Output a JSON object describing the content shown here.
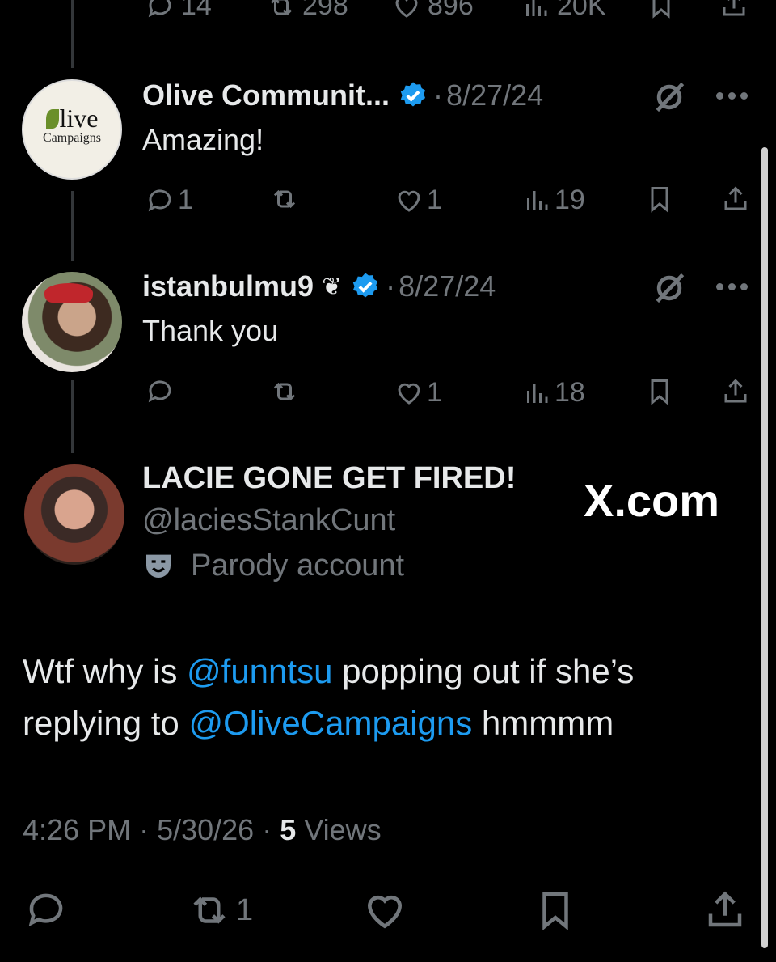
{
  "top_actions": {
    "replies": "14",
    "reposts": "298",
    "likes": "896",
    "views": "20K"
  },
  "reply1": {
    "avatar_text_main": "live",
    "avatar_text_sub": "Campaigns",
    "name": "Olive Communit...",
    "date": "8/27/24",
    "text": "Amazing!",
    "replies": "1",
    "likes": "1",
    "views": "19"
  },
  "reply2": {
    "name": "istanbulmu9",
    "emoji": "❦",
    "date": "8/27/24",
    "text": "Thank you",
    "likes": "1",
    "views": "18"
  },
  "main_post": {
    "name": "LACIE GONE GET FIRED!",
    "handle": "@laciesStankCunt",
    "parody_label": "Parody account",
    "watermark": "X.com",
    "text_part1": "Wtf why is ",
    "mention1": "@funntsu",
    "text_part2": " popping out if she’s replying to ",
    "mention2": "@OliveCampaigns",
    "text_part3": " hmmmm",
    "time": "4:26 PM",
    "date": "5/30/26",
    "views_count": "5",
    "views_label": "Views",
    "reposts": "1"
  },
  "colors": {
    "accent": "#1d9bf0",
    "muted": "#71767b",
    "text": "#e7e9ea",
    "background": "#000000"
  }
}
